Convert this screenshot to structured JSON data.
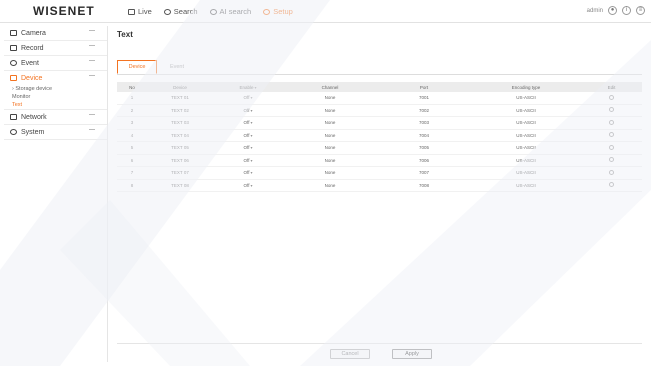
{
  "brand": "WISENET",
  "nav": [
    {
      "label": "Live",
      "active": false
    },
    {
      "label": "Search",
      "active": false
    },
    {
      "label": "AI search",
      "active": false
    },
    {
      "label": "Setup",
      "active": true
    }
  ],
  "topright": {
    "user": "admin"
  },
  "sidebar": {
    "items": [
      {
        "label": "Camera",
        "icon": "camera-icon",
        "active": false
      },
      {
        "label": "Record",
        "icon": "record-icon",
        "active": false
      },
      {
        "label": "Event",
        "icon": "event-icon",
        "active": false
      },
      {
        "label": "Device",
        "icon": "device-icon",
        "active": true
      }
    ],
    "subitems": [
      {
        "label": "Storage device",
        "active": false
      },
      {
        "label": "Monitor",
        "active": false
      },
      {
        "label": "Text",
        "active": true
      }
    ],
    "items2": [
      {
        "label": "Network",
        "icon": "network-icon"
      },
      {
        "label": "System",
        "icon": "system-icon"
      }
    ]
  },
  "page": {
    "title": "Text"
  },
  "tabs": [
    {
      "label": "Device",
      "active": true
    },
    {
      "label": "Event",
      "active": false
    }
  ],
  "table": {
    "headers": [
      "No",
      "Device",
      "Enable",
      "Channel",
      "Port",
      "Encoding type",
      "Edit"
    ],
    "rows": [
      {
        "no": "1",
        "device": "TEXT 01",
        "enable": "Off",
        "channel": "None",
        "port": "7001",
        "encoding": "US-ASCII"
      },
      {
        "no": "2",
        "device": "TEXT 02",
        "enable": "Off",
        "channel": "None",
        "port": "7002",
        "encoding": "US-ASCII"
      },
      {
        "no": "3",
        "device": "TEXT 03",
        "enable": "Off",
        "channel": "None",
        "port": "7003",
        "encoding": "US-ASCII"
      },
      {
        "no": "4",
        "device": "TEXT 04",
        "enable": "Off",
        "channel": "None",
        "port": "7004",
        "encoding": "US-ASCII"
      },
      {
        "no": "5",
        "device": "TEXT 05",
        "enable": "Off",
        "channel": "None",
        "port": "7005",
        "encoding": "US-ASCII"
      },
      {
        "no": "6",
        "device": "TEXT 06",
        "enable": "Off",
        "channel": "None",
        "port": "7006",
        "encoding": "US-ASCII"
      },
      {
        "no": "7",
        "device": "TEXT 07",
        "enable": "Off",
        "channel": "None",
        "port": "7007",
        "encoding": "US-ASCII"
      },
      {
        "no": "8",
        "device": "TEXT 08",
        "enable": "Off",
        "channel": "None",
        "port": "7008",
        "encoding": "US-ASCII"
      }
    ]
  },
  "buttons": {
    "cancel": "Cancel",
    "apply": "Apply"
  },
  "colors": {
    "accent": "#f37321"
  }
}
